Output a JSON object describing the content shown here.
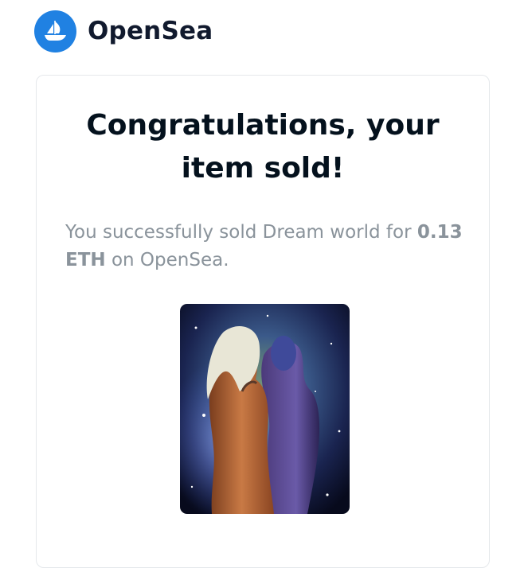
{
  "brand": {
    "name": "OpenSea",
    "logo_icon": "opensea-sailboat-icon",
    "color": "#2081e2"
  },
  "email": {
    "headline_line1": "Congratulations, your",
    "headline_line2": "item sold!",
    "message_prefix": "You successfully sold Dream world for",
    "amount": "0.13 ETH",
    "message_suffix": "on OpenSea."
  },
  "item": {
    "image_icon": "nft-artwork-image"
  }
}
